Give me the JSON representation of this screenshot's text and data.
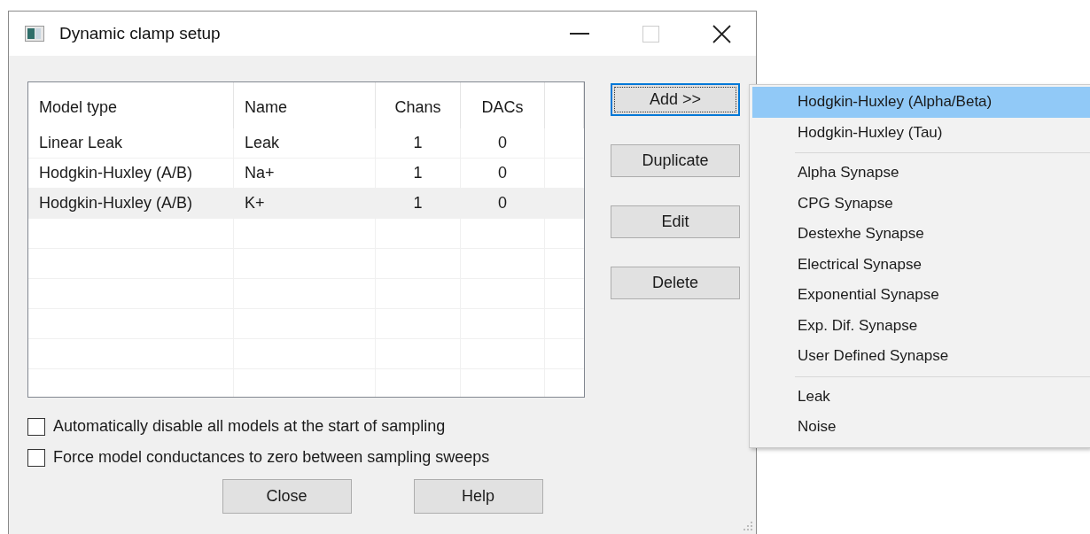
{
  "window": {
    "title": "Dynamic clamp setup"
  },
  "table": {
    "columns": [
      "Model type",
      "Name",
      "Chans",
      "DACs"
    ],
    "rows": [
      {
        "cells": [
          "Linear Leak",
          "Leak",
          "1",
          "0"
        ],
        "selected": false
      },
      {
        "cells": [
          "Hodgkin-Huxley (A/B)",
          "Na+",
          "1",
          "0"
        ],
        "selected": false
      },
      {
        "cells": [
          "Hodgkin-Huxley (A/B)",
          "K+",
          "1",
          "0"
        ],
        "selected": true
      }
    ]
  },
  "side_buttons": [
    {
      "label": "Add >>",
      "focused": true
    },
    {
      "label": "Duplicate",
      "focused": false
    },
    {
      "label": "Edit",
      "focused": false
    },
    {
      "label": "Delete",
      "focused": false
    }
  ],
  "options": [
    {
      "label": "Automatically disable all models at the start of sampling",
      "checked": false
    },
    {
      "label": "Force model conductances to zero between sampling sweeps",
      "checked": false
    }
  ],
  "bottom_buttons": [
    "Close",
    "Help"
  ],
  "menu": {
    "items": [
      {
        "kind": "item",
        "label": "Hodgkin-Huxley (Alpha/Beta)",
        "selected": true
      },
      {
        "kind": "item",
        "label": "Hodgkin-Huxley (Tau)",
        "selected": false
      },
      {
        "kind": "separator"
      },
      {
        "kind": "item",
        "label": "Alpha Synapse",
        "selected": false
      },
      {
        "kind": "item",
        "label": "CPG Synapse",
        "selected": false
      },
      {
        "kind": "item",
        "label": "Destexhe Synapse",
        "selected": false
      },
      {
        "kind": "item",
        "label": "Electrical Synapse",
        "selected": false
      },
      {
        "kind": "item",
        "label": "Exponential Synapse",
        "selected": false
      },
      {
        "kind": "item",
        "label": "Exp. Dif. Synapse",
        "selected": false
      },
      {
        "kind": "item",
        "label": "User Defined Synapse",
        "selected": false
      },
      {
        "kind": "separator"
      },
      {
        "kind": "item",
        "label": "Leak",
        "selected": false
      },
      {
        "kind": "item",
        "label": "Noise",
        "selected": false
      }
    ]
  }
}
